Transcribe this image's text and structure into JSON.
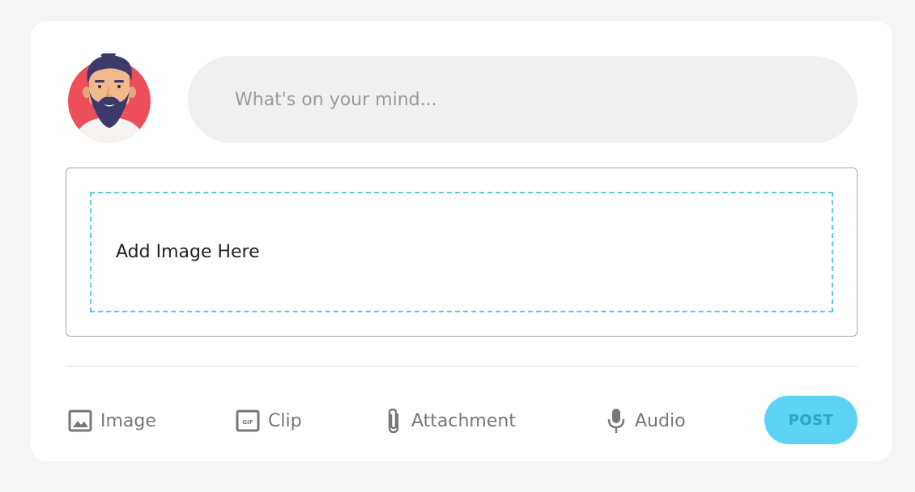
{
  "composer": {
    "placeholder": "What's on your mind...",
    "avatar_icon": "bearded-man-avatar"
  },
  "dropzone": {
    "label": "Add Image Here"
  },
  "actions": [
    {
      "label": "Image",
      "icon": "image-icon"
    },
    {
      "label": "Clip",
      "icon": "gif-icon"
    },
    {
      "label": "Attachment",
      "icon": "paperclip-icon"
    },
    {
      "label": "Audio",
      "icon": "microphone-icon"
    }
  ],
  "post_button": {
    "label": "POST"
  },
  "colors": {
    "accent": "#5ed2f3",
    "dashed_border": "#5ec8e6",
    "avatar_bg": "#ec4f5a",
    "input_bg": "#f0f0f0"
  }
}
